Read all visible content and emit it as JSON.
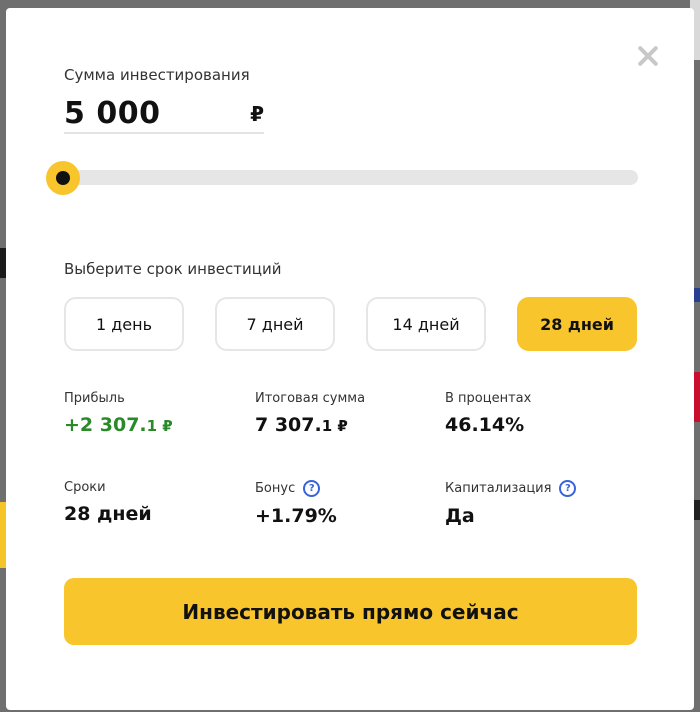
{
  "modal": {
    "close_symbol": ""
  },
  "investment": {
    "amount_label": "Сумма инвестирования",
    "amount_value": "5 000",
    "currency": "₽",
    "slider_position": 0.0
  },
  "term": {
    "label": "Выберите срок инвестиций",
    "options": [
      {
        "label": "1 день",
        "active": false
      },
      {
        "label": "7 дней",
        "active": false
      },
      {
        "label": "14 дней",
        "active": false
      },
      {
        "label": "28 дней",
        "active": true
      }
    ]
  },
  "stats": {
    "profit": {
      "label": "Прибыль",
      "value_main": "+2 307.",
      "value_small": "1 ₽"
    },
    "total": {
      "label": "Итоговая сумма",
      "value_main": "7 307.",
      "value_small": "1 ₽"
    },
    "percent": {
      "label": "В процентах",
      "value": "46.14%"
    },
    "period": {
      "label": "Сроки",
      "value": "28 дней"
    },
    "bonus": {
      "label": "Бонус",
      "value": "+1.79%",
      "help": "?"
    },
    "capitalization": {
      "label": "Капитализация",
      "value": "Да",
      "help": "?"
    }
  },
  "cta": {
    "label": "Инвестировать прямо сейчас"
  },
  "colors": {
    "accent": "#f8c52c",
    "profit_green": "#2a8a2a",
    "help_blue": "#3b63d9"
  }
}
